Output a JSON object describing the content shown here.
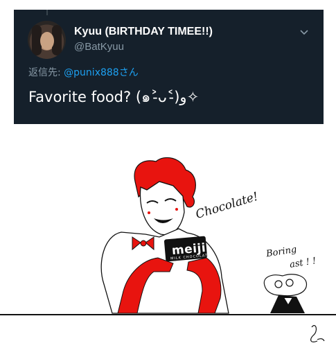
{
  "tweet": {
    "display_name": "Kyuu (BIRTHDAY TIMEE!!)",
    "handle": "@BatKyuu",
    "reply_prefix": "返信先: ",
    "reply_mention": "@punix888",
    "reply_suffix": "さん",
    "text": "Favorite food? (๑˃̵ᴗ˂̵)و✧",
    "icons": [
      "avatar",
      "chevron-down-icon"
    ]
  },
  "drawing": {
    "speech_main": "Chocolate!",
    "speech_side_line1": "Boring",
    "speech_side_line2": "ast ! !",
    "bar_brand": "meiji",
    "bar_subtitle": "MILK CHOCOLATE"
  },
  "colors": {
    "tweet_bg": "#15202b",
    "secondary_text": "#8899a6",
    "mention": "#1da1f2",
    "accent_red": "#e8140f"
  }
}
